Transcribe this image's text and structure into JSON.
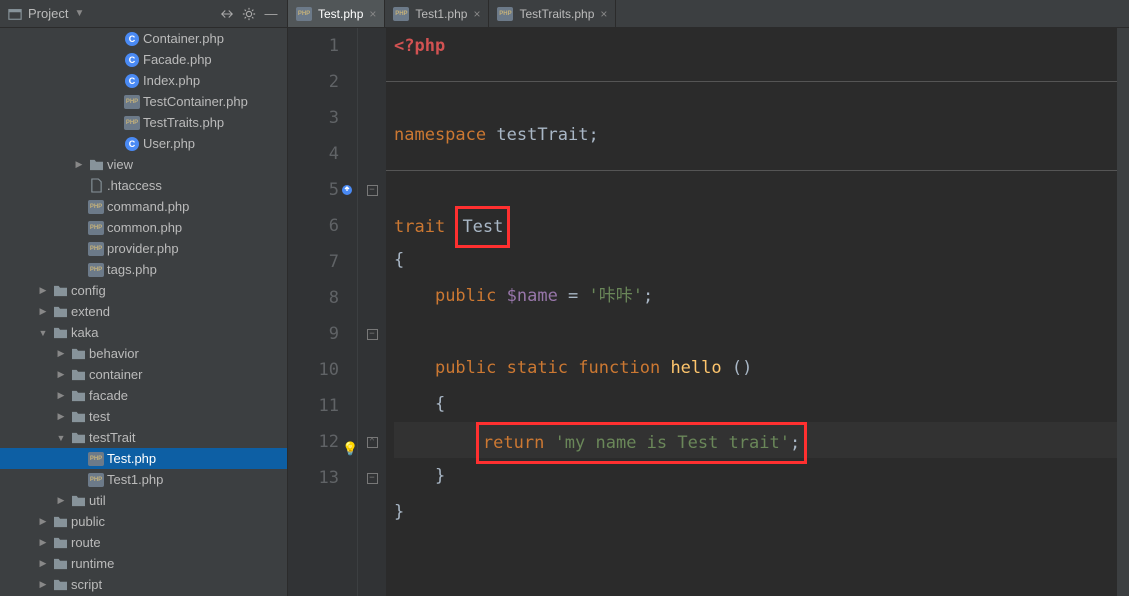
{
  "header": {
    "project_label": "Project"
  },
  "tabs": [
    {
      "label": "Test.php",
      "active": true
    },
    {
      "label": "Test1.php",
      "active": false
    },
    {
      "label": "TestTraits.php",
      "active": false
    }
  ],
  "tree": [
    {
      "d": 5,
      "icon": "class",
      "label": "Container.php"
    },
    {
      "d": 5,
      "icon": "class",
      "label": "Facade.php"
    },
    {
      "d": 5,
      "icon": "class",
      "label": "Index.php"
    },
    {
      "d": 5,
      "icon": "php",
      "label": "TestContainer.php"
    },
    {
      "d": 5,
      "icon": "php",
      "label": "TestTraits.php"
    },
    {
      "d": 5,
      "icon": "class",
      "label": "User.php"
    },
    {
      "d": 3,
      "arrow": "r",
      "icon": "folder",
      "label": "view"
    },
    {
      "d": 3,
      "icon": "file",
      "label": ".htaccess"
    },
    {
      "d": 3,
      "icon": "php",
      "label": "command.php"
    },
    {
      "d": 3,
      "icon": "php",
      "label": "common.php"
    },
    {
      "d": 3,
      "icon": "php",
      "label": "provider.php"
    },
    {
      "d": 3,
      "icon": "php",
      "label": "tags.php"
    },
    {
      "d": 1,
      "arrow": "r",
      "icon": "folder",
      "label": "config"
    },
    {
      "d": 1,
      "arrow": "r",
      "icon": "folder",
      "label": "extend"
    },
    {
      "d": 1,
      "arrow": "d",
      "icon": "folder",
      "label": "kaka"
    },
    {
      "d": 2,
      "arrow": "r",
      "icon": "folder",
      "label": "behavior"
    },
    {
      "d": 2,
      "arrow": "r",
      "icon": "folder",
      "label": "container"
    },
    {
      "d": 2,
      "arrow": "r",
      "icon": "folder",
      "label": "facade"
    },
    {
      "d": 2,
      "arrow": "r",
      "icon": "folder",
      "label": "test"
    },
    {
      "d": 2,
      "arrow": "d",
      "icon": "folder",
      "label": "testTrait"
    },
    {
      "d": 3,
      "icon": "php",
      "label": "Test.php",
      "sel": true
    },
    {
      "d": 3,
      "icon": "php",
      "label": "Test1.php"
    },
    {
      "d": 2,
      "arrow": "r",
      "icon": "folder",
      "label": "util"
    },
    {
      "d": 1,
      "arrow": "r",
      "icon": "folder",
      "label": "public"
    },
    {
      "d": 1,
      "arrow": "r",
      "icon": "folder",
      "label": "route"
    },
    {
      "d": 1,
      "arrow": "r",
      "icon": "folder",
      "label": "runtime"
    },
    {
      "d": 1,
      "arrow": "r",
      "icon": "folder",
      "label": "script"
    }
  ],
  "code": {
    "lines": [
      "1",
      "2",
      "3",
      "4",
      "5",
      "6",
      "7",
      "8",
      "9",
      "10",
      "11",
      "12",
      "13"
    ],
    "open_tag": "<?php",
    "ns_kw": "namespace",
    "ns_name": "testTrait",
    "trait_kw": "trait",
    "trait_name": "Test",
    "brace_o": "{",
    "pub": "public",
    "var": "$name",
    "eq": " = ",
    "name_str": "'咔咔'",
    "static": "static",
    "func": "function",
    "fn_name": "hello",
    "parens": " ()",
    "return": "return",
    "ret_str": "'my name is Test trait'",
    "semi": ";",
    "brace_c": "}"
  }
}
